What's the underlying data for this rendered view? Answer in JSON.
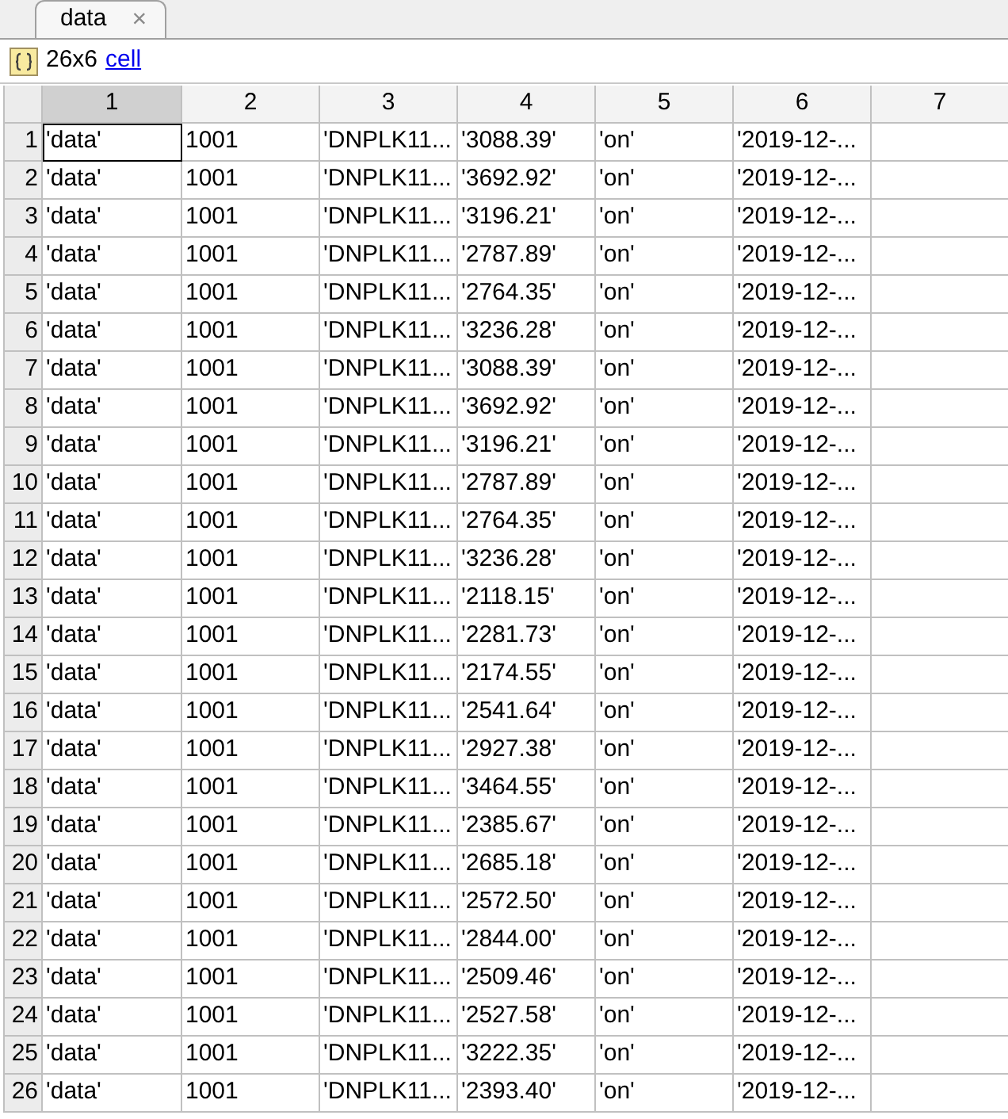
{
  "tabs": [
    {
      "label": "data",
      "selected": true,
      "close": "×"
    }
  ],
  "info": {
    "size": "26x6",
    "class_link": "cell"
  },
  "table": {
    "columns": [
      {
        "label": "1",
        "selected": true
      },
      {
        "label": "2",
        "selected": false
      },
      {
        "label": "3",
        "selected": false
      },
      {
        "label": "4",
        "selected": false
      },
      {
        "label": "5",
        "selected": false
      },
      {
        "label": "6",
        "selected": false
      },
      {
        "label": "7",
        "selected": false
      }
    ],
    "rows": [
      {
        "label": "1",
        "cells": [
          {
            "text": "'data'",
            "selected": true
          },
          {
            "text": "1001",
            "selected": false
          },
          {
            "text": "'DNPLK11...",
            "selected": false
          },
          {
            "text": "'3088.39'",
            "selected": false
          },
          {
            "text": "'on'",
            "selected": false
          },
          {
            "text": "'2019-12-...",
            "selected": false
          }
        ]
      },
      {
        "label": "2",
        "cells": [
          {
            "text": "'data'",
            "selected": false
          },
          {
            "text": "1001",
            "selected": false
          },
          {
            "text": "'DNPLK11...",
            "selected": false
          },
          {
            "text": "'3692.92'",
            "selected": false
          },
          {
            "text": "'on'",
            "selected": false
          },
          {
            "text": "'2019-12-...",
            "selected": false
          }
        ]
      },
      {
        "label": "3",
        "cells": [
          {
            "text": "'data'",
            "selected": false
          },
          {
            "text": "1001",
            "selected": false
          },
          {
            "text": "'DNPLK11...",
            "selected": false
          },
          {
            "text": "'3196.21'",
            "selected": false
          },
          {
            "text": "'on'",
            "selected": false
          },
          {
            "text": "'2019-12-...",
            "selected": false
          }
        ]
      },
      {
        "label": "4",
        "cells": [
          {
            "text": "'data'",
            "selected": false
          },
          {
            "text": "1001",
            "selected": false
          },
          {
            "text": "'DNPLK11...",
            "selected": false
          },
          {
            "text": "'2787.89'",
            "selected": false
          },
          {
            "text": "'on'",
            "selected": false
          },
          {
            "text": "'2019-12-...",
            "selected": false
          }
        ]
      },
      {
        "label": "5",
        "cells": [
          {
            "text": "'data'",
            "selected": false
          },
          {
            "text": "1001",
            "selected": false
          },
          {
            "text": "'DNPLK11...",
            "selected": false
          },
          {
            "text": "'2764.35'",
            "selected": false
          },
          {
            "text": "'on'",
            "selected": false
          },
          {
            "text": "'2019-12-...",
            "selected": false
          }
        ]
      },
      {
        "label": "6",
        "cells": [
          {
            "text": "'data'",
            "selected": false
          },
          {
            "text": "1001",
            "selected": false
          },
          {
            "text": "'DNPLK11...",
            "selected": false
          },
          {
            "text": "'3236.28'",
            "selected": false
          },
          {
            "text": "'on'",
            "selected": false
          },
          {
            "text": "'2019-12-...",
            "selected": false
          }
        ]
      },
      {
        "label": "7",
        "cells": [
          {
            "text": "'data'",
            "selected": false
          },
          {
            "text": "1001",
            "selected": false
          },
          {
            "text": "'DNPLK11...",
            "selected": false
          },
          {
            "text": "'3088.39'",
            "selected": false
          },
          {
            "text": "'on'",
            "selected": false
          },
          {
            "text": "'2019-12-...",
            "selected": false
          }
        ]
      },
      {
        "label": "8",
        "cells": [
          {
            "text": "'data'",
            "selected": false
          },
          {
            "text": "1001",
            "selected": false
          },
          {
            "text": "'DNPLK11...",
            "selected": false
          },
          {
            "text": "'3692.92'",
            "selected": false
          },
          {
            "text": "'on'",
            "selected": false
          },
          {
            "text": "'2019-12-...",
            "selected": false
          }
        ]
      },
      {
        "label": "9",
        "cells": [
          {
            "text": "'data'",
            "selected": false
          },
          {
            "text": "1001",
            "selected": false
          },
          {
            "text": "'DNPLK11...",
            "selected": false
          },
          {
            "text": "'3196.21'",
            "selected": false
          },
          {
            "text": "'on'",
            "selected": false
          },
          {
            "text": "'2019-12-...",
            "selected": false
          }
        ]
      },
      {
        "label": "10",
        "cells": [
          {
            "text": "'data'",
            "selected": false
          },
          {
            "text": "1001",
            "selected": false
          },
          {
            "text": "'DNPLK11...",
            "selected": false
          },
          {
            "text": "'2787.89'",
            "selected": false
          },
          {
            "text": "'on'",
            "selected": false
          },
          {
            "text": "'2019-12-...",
            "selected": false
          }
        ]
      },
      {
        "label": "11",
        "cells": [
          {
            "text": "'data'",
            "selected": false
          },
          {
            "text": "1001",
            "selected": false
          },
          {
            "text": "'DNPLK11...",
            "selected": false
          },
          {
            "text": "'2764.35'",
            "selected": false
          },
          {
            "text": "'on'",
            "selected": false
          },
          {
            "text": "'2019-12-...",
            "selected": false
          }
        ]
      },
      {
        "label": "12",
        "cells": [
          {
            "text": "'data'",
            "selected": false
          },
          {
            "text": "1001",
            "selected": false
          },
          {
            "text": "'DNPLK11...",
            "selected": false
          },
          {
            "text": "'3236.28'",
            "selected": false
          },
          {
            "text": "'on'",
            "selected": false
          },
          {
            "text": "'2019-12-...",
            "selected": false
          }
        ]
      },
      {
        "label": "13",
        "cells": [
          {
            "text": "'data'",
            "selected": false
          },
          {
            "text": "1001",
            "selected": false
          },
          {
            "text": "'DNPLK11...",
            "selected": false
          },
          {
            "text": "'2118.15'",
            "selected": false
          },
          {
            "text": "'on'",
            "selected": false
          },
          {
            "text": "'2019-12-...",
            "selected": false
          }
        ]
      },
      {
        "label": "14",
        "cells": [
          {
            "text": "'data'",
            "selected": false
          },
          {
            "text": "1001",
            "selected": false
          },
          {
            "text": "'DNPLK11...",
            "selected": false
          },
          {
            "text": "'2281.73'",
            "selected": false
          },
          {
            "text": "'on'",
            "selected": false
          },
          {
            "text": "'2019-12-...",
            "selected": false
          }
        ]
      },
      {
        "label": "15",
        "cells": [
          {
            "text": "'data'",
            "selected": false
          },
          {
            "text": "1001",
            "selected": false
          },
          {
            "text": "'DNPLK11...",
            "selected": false
          },
          {
            "text": "'2174.55'",
            "selected": false
          },
          {
            "text": "'on'",
            "selected": false
          },
          {
            "text": "'2019-12-...",
            "selected": false
          }
        ]
      },
      {
        "label": "16",
        "cells": [
          {
            "text": "'data'",
            "selected": false
          },
          {
            "text": "1001",
            "selected": false
          },
          {
            "text": "'DNPLK11...",
            "selected": false
          },
          {
            "text": "'2541.64'",
            "selected": false
          },
          {
            "text": "'on'",
            "selected": false
          },
          {
            "text": "'2019-12-...",
            "selected": false
          }
        ]
      },
      {
        "label": "17",
        "cells": [
          {
            "text": "'data'",
            "selected": false
          },
          {
            "text": "1001",
            "selected": false
          },
          {
            "text": "'DNPLK11...",
            "selected": false
          },
          {
            "text": "'2927.38'",
            "selected": false
          },
          {
            "text": "'on'",
            "selected": false
          },
          {
            "text": "'2019-12-...",
            "selected": false
          }
        ]
      },
      {
        "label": "18",
        "cells": [
          {
            "text": "'data'",
            "selected": false
          },
          {
            "text": "1001",
            "selected": false
          },
          {
            "text": "'DNPLK11...",
            "selected": false
          },
          {
            "text": "'3464.55'",
            "selected": false
          },
          {
            "text": "'on'",
            "selected": false
          },
          {
            "text": "'2019-12-...",
            "selected": false
          }
        ]
      },
      {
        "label": "19",
        "cells": [
          {
            "text": "'data'",
            "selected": false
          },
          {
            "text": "1001",
            "selected": false
          },
          {
            "text": "'DNPLK11...",
            "selected": false
          },
          {
            "text": "'2385.67'",
            "selected": false
          },
          {
            "text": "'on'",
            "selected": false
          },
          {
            "text": "'2019-12-...",
            "selected": false
          }
        ]
      },
      {
        "label": "20",
        "cells": [
          {
            "text": "'data'",
            "selected": false
          },
          {
            "text": "1001",
            "selected": false
          },
          {
            "text": "'DNPLK11...",
            "selected": false
          },
          {
            "text": "'2685.18'",
            "selected": false
          },
          {
            "text": "'on'",
            "selected": false
          },
          {
            "text": "'2019-12-...",
            "selected": false
          }
        ]
      },
      {
        "label": "21",
        "cells": [
          {
            "text": "'data'",
            "selected": false
          },
          {
            "text": "1001",
            "selected": false
          },
          {
            "text": "'DNPLK11...",
            "selected": false
          },
          {
            "text": "'2572.50'",
            "selected": false
          },
          {
            "text": "'on'",
            "selected": false
          },
          {
            "text": "'2019-12-...",
            "selected": false
          }
        ]
      },
      {
        "label": "22",
        "cells": [
          {
            "text": "'data'",
            "selected": false
          },
          {
            "text": "1001",
            "selected": false
          },
          {
            "text": "'DNPLK11...",
            "selected": false
          },
          {
            "text": "'2844.00'",
            "selected": false
          },
          {
            "text": "'on'",
            "selected": false
          },
          {
            "text": "'2019-12-...",
            "selected": false
          }
        ]
      },
      {
        "label": "23",
        "cells": [
          {
            "text": "'data'",
            "selected": false
          },
          {
            "text": "1001",
            "selected": false
          },
          {
            "text": "'DNPLK11...",
            "selected": false
          },
          {
            "text": "'2509.46'",
            "selected": false
          },
          {
            "text": "'on'",
            "selected": false
          },
          {
            "text": "'2019-12-...",
            "selected": false
          }
        ]
      },
      {
        "label": "24",
        "cells": [
          {
            "text": "'data'",
            "selected": false
          },
          {
            "text": "1001",
            "selected": false
          },
          {
            "text": "'DNPLK11...",
            "selected": false
          },
          {
            "text": "'2527.58'",
            "selected": false
          },
          {
            "text": "'on'",
            "selected": false
          },
          {
            "text": "'2019-12-...",
            "selected": false
          }
        ]
      },
      {
        "label": "25",
        "cells": [
          {
            "text": "'data'",
            "selected": false
          },
          {
            "text": "1001",
            "selected": false
          },
          {
            "text": "'DNPLK11...",
            "selected": false
          },
          {
            "text": "'3222.35'",
            "selected": false
          },
          {
            "text": "'on'",
            "selected": false
          },
          {
            "text": "'2019-12-...",
            "selected": false
          }
        ]
      },
      {
        "label": "26",
        "cells": [
          {
            "text": "'data'",
            "selected": false
          },
          {
            "text": "1001",
            "selected": false
          },
          {
            "text": "'DNPLK11...",
            "selected": false
          },
          {
            "text": "'2393.40'",
            "selected": false
          },
          {
            "text": "'on'",
            "selected": false
          },
          {
            "text": "'2019-12-...",
            "selected": false
          }
        ]
      }
    ]
  }
}
